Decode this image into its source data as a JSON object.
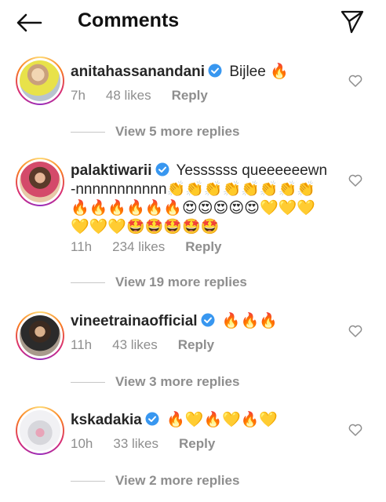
{
  "header": {
    "title": "Comments",
    "back_icon": "arrow-left-icon",
    "send_icon": "paper-plane-icon"
  },
  "comments": [
    {
      "username": "anitahassanandani",
      "verified": true,
      "text": "Bijlee 🔥",
      "time": "7h",
      "likes": "48 likes",
      "reply": "Reply",
      "view_more": "View 5 more replies"
    },
    {
      "username": "palaktiwarii",
      "verified": true,
      "text": "Yessssss queeeeeewn-nnnnnnnnnnn👏👏👏👏👏👏👏👏🔥🔥🔥🔥🔥🔥😍😍😍😍😍💛💛💛💛💛💛🤩🤩🤩🤩🤩",
      "time": "11h",
      "likes": "234 likes",
      "reply": "Reply",
      "view_more": "View 19 more replies"
    },
    {
      "username": "vineetrainaofficial",
      "verified": true,
      "text": "🔥🔥🔥",
      "time": "11h",
      "likes": "43 likes",
      "reply": "Reply",
      "view_more": "View 3 more replies"
    },
    {
      "username": "kskadakia",
      "verified": true,
      "text": "🔥💛🔥💛🔥💛",
      "time": "10h",
      "likes": "33 likes",
      "reply": "Reply",
      "view_more": "View 2 more replies"
    }
  ],
  "colors": {
    "verified_blue": "#3897f0",
    "secondary_text": "#8e8e8e",
    "primary_text": "#262626"
  }
}
